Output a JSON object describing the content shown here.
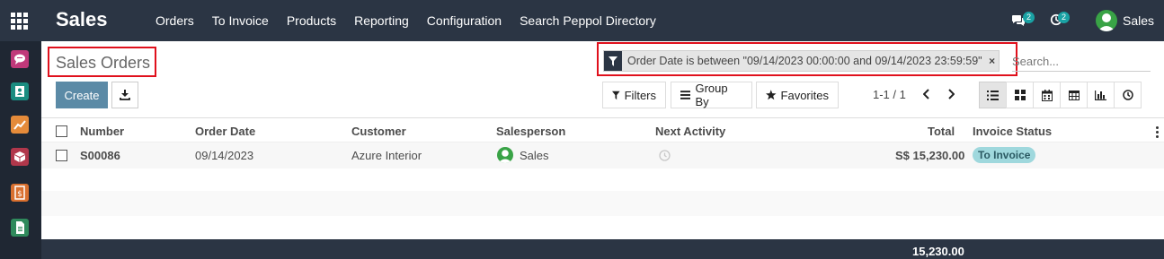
{
  "navbar": {
    "app_name": "Sales",
    "menu": [
      "Orders",
      "To Invoice",
      "Products",
      "Reporting",
      "Configuration",
      "Search Peppol Directory"
    ],
    "messages_count": "2",
    "activities_count": "2",
    "user_name": "Sales"
  },
  "control_panel": {
    "breadcrumb": "Sales Orders",
    "facet_text": "Order Date is between \"09/14/2023 00:00:00 and 09/14/2023 23:59:59\"",
    "facet_close": "×",
    "search_placeholder": "Search...",
    "create_label": "Create",
    "filters_label": "Filters",
    "group_by_label": "Group By",
    "favorites_label": "Favorites",
    "pager": "1-1 / 1"
  },
  "list": {
    "columns": [
      "Number",
      "Order Date",
      "Customer",
      "Salesperson",
      "Next Activity",
      "Total",
      "Invoice Status"
    ],
    "rows": [
      {
        "number": "S00086",
        "order_date": "09/14/2023",
        "customer": "Azure Interior",
        "salesperson": "Sales",
        "total": "S$ 15,230.00",
        "invoice_status": "To Invoice"
      }
    ],
    "footer_total": "15,230.00"
  },
  "colors": {
    "navbar": "#2b3544",
    "accent": "#5b8aa6",
    "highlight": "#e0101c",
    "badge": "#1aa2a4"
  }
}
